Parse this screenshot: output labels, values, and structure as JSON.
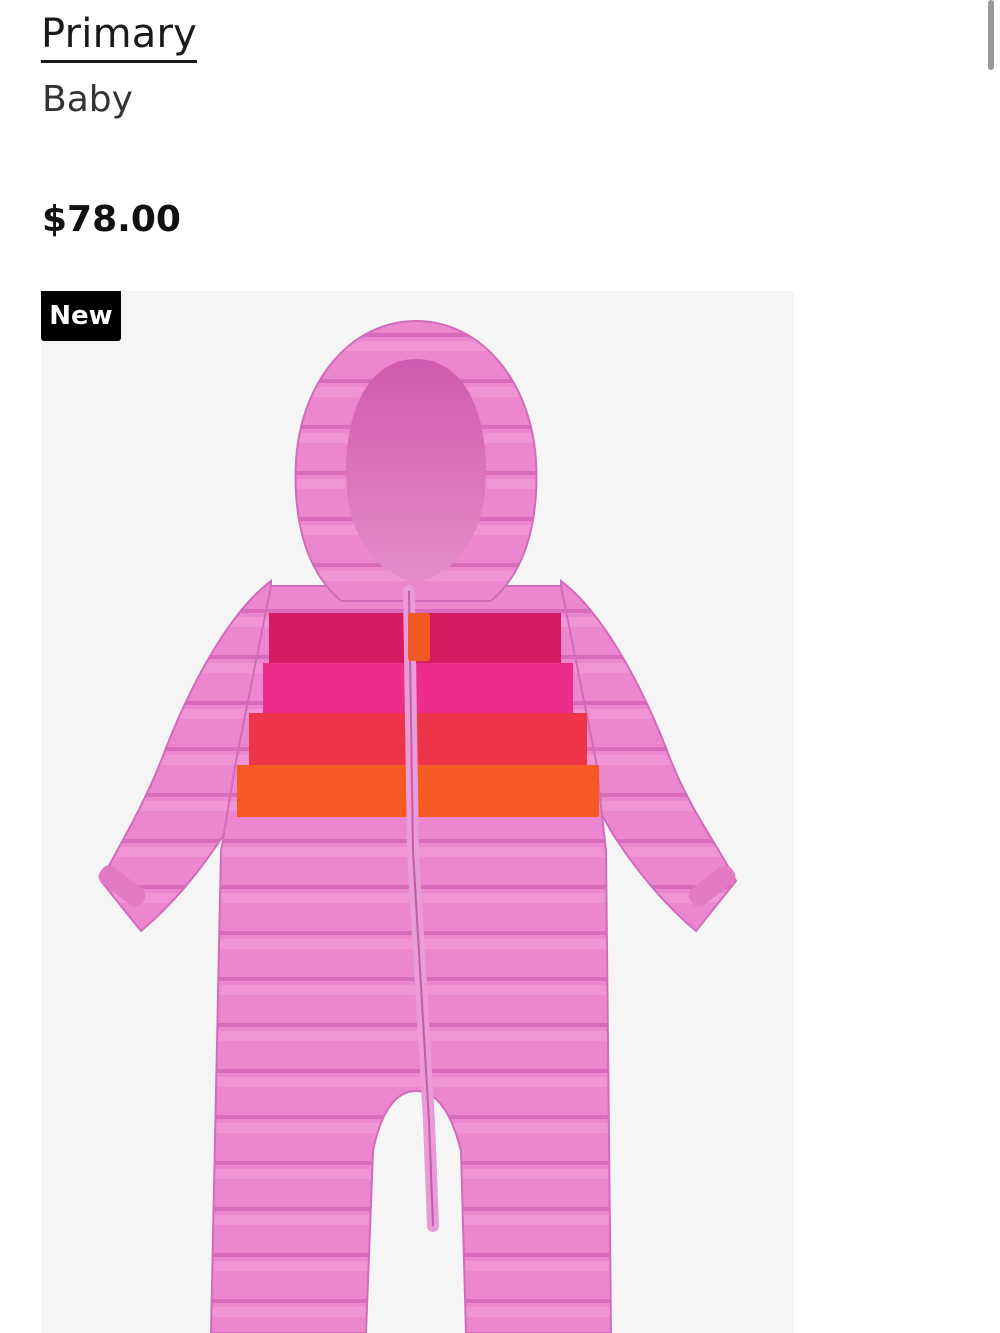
{
  "product": {
    "brand": "Primary",
    "category": "Baby",
    "price": "$78.00",
    "badge": "New",
    "image_icon": "pink-puffer-snowsuit-image"
  },
  "colors": {
    "body_pink": "#ec86cf",
    "stripe_1": "#d61a63",
    "stripe_2": "#ee2d8a",
    "stripe_3": "#ee3448",
    "stripe_4": "#f45a22",
    "zipper_pull": "#f05a22",
    "background": "#f5f5f5"
  }
}
